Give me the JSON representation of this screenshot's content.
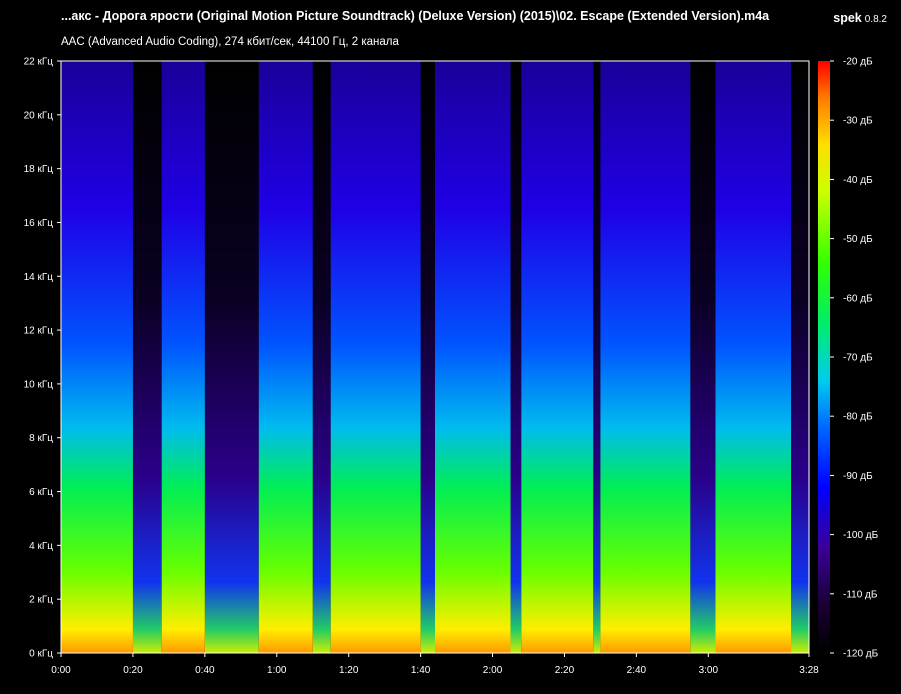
{
  "header": {
    "title": "...акс - Дорога ярости (Original Motion Picture Soundtrack) (Deluxe Version) (2015)\\02. Escape (Extended Version).m4a",
    "app_name": "spek",
    "app_version": "0.8.2",
    "file_info": "AAC (Advanced Audio Coding), 274 кбит/сек, 44100 Гц, 2 канала"
  },
  "chart_data": {
    "type": "heatmap",
    "title": "",
    "xlabel": "",
    "ylabel": "",
    "x_ticks": [
      "0:00",
      "0:20",
      "0:40",
      "1:00",
      "1:20",
      "1:40",
      "2:00",
      "2:20",
      "2:40",
      "3:00",
      "3:28"
    ],
    "x_tick_seconds": [
      0,
      20,
      40,
      60,
      80,
      100,
      120,
      140,
      160,
      180,
      208
    ],
    "xlim_seconds": [
      0,
      208
    ],
    "y_ticks": [
      "0 кГц",
      "2 кГц",
      "4 кГц",
      "6 кГц",
      "8 кГц",
      "10 кГц",
      "12 кГц",
      "14 кГц",
      "16 кГц",
      "18 кГц",
      "20 кГц",
      "22 кГц"
    ],
    "y_tick_khz": [
      0,
      2,
      4,
      6,
      8,
      10,
      12,
      14,
      16,
      18,
      20,
      22
    ],
    "ylim_khz": [
      0,
      22
    ],
    "colorbar": {
      "labels": [
        "-20 дБ",
        "-30 дБ",
        "-40 дБ",
        "-50 дБ",
        "-60 дБ",
        "-70 дБ",
        "-80 дБ",
        "-90 дБ",
        "-100 дБ",
        "-110 дБ",
        "-120 дБ"
      ],
      "values_db": [
        -20,
        -30,
        -40,
        -50,
        -60,
        -70,
        -80,
        -90,
        -100,
        -110,
        -120
      ],
      "range_db": [
        -120,
        -20
      ],
      "colors": [
        "#ff0000",
        "#ff9900",
        "#ffff00",
        "#00ff00",
        "#00ffcc",
        "#0000ff",
        "#330066",
        "#000000"
      ]
    },
    "loud_sections_seconds": [
      [
        0,
        20
      ],
      [
        28,
        40
      ],
      [
        55,
        70
      ],
      [
        75,
        100
      ],
      [
        104,
        125
      ],
      [
        128,
        148
      ],
      [
        150,
        175
      ],
      [
        182,
        203
      ]
    ],
    "quiet_gaps_seconds": [
      [
        20,
        28
      ],
      [
        40,
        55
      ],
      [
        70,
        75
      ],
      [
        100,
        104
      ],
      [
        125,
        128
      ],
      [
        148,
        150
      ],
      [
        175,
        182
      ],
      [
        203,
        208
      ]
    ]
  }
}
